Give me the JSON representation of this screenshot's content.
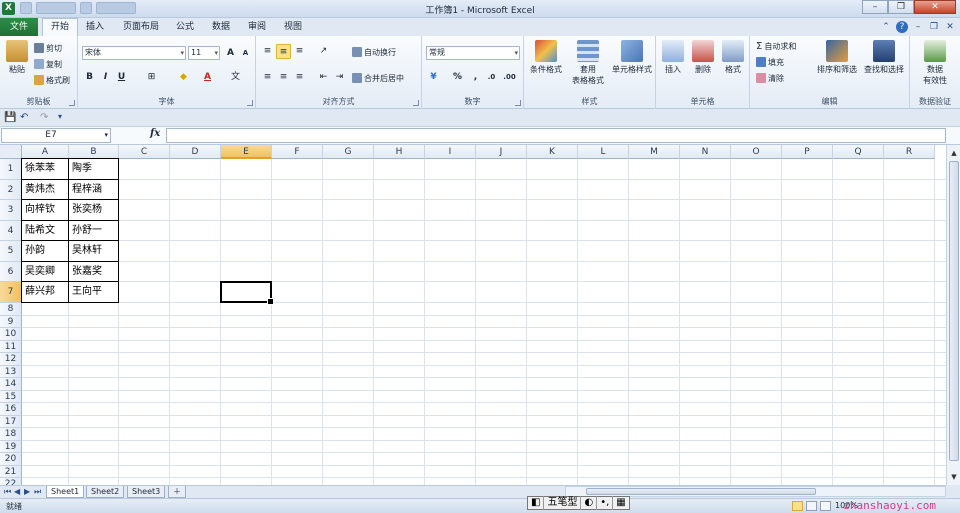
{
  "window": {
    "title": "工作簿1 - Microsoft Excel",
    "minimize": "–",
    "restore": "❐",
    "close": "✕"
  },
  "ribbon_tabs": [
    "文件",
    "开始",
    "插入",
    "页面布局",
    "公式",
    "数据",
    "审阅",
    "视图"
  ],
  "ribbon": {
    "clipboard": {
      "label": "剪贴板",
      "paste": "粘贴",
      "cut": "剪切",
      "copy": "复制",
      "format_painter": "格式刷"
    },
    "font": {
      "label": "字体",
      "font_name": "宋体",
      "font_size": "11",
      "bold": "B",
      "italic": "I",
      "underline": "U",
      "grow": "A",
      "shrink": "A"
    },
    "alignment": {
      "label": "对齐方式",
      "wrap": "自动换行",
      "merge": "合并后居中"
    },
    "number": {
      "label": "数字",
      "format": "常规",
      "percent": "%",
      "comma": ","
    },
    "styles": {
      "label": "样式",
      "conditional": "条件格式",
      "table_line1": "套用",
      "table_line2": "表格格式",
      "cell_styles": "单元格样式"
    },
    "cells": {
      "label": "单元格",
      "insert": "插入",
      "delete": "删除",
      "format": "格式"
    },
    "editing": {
      "label": "编辑",
      "autosum": "自动求和",
      "fill": "填充",
      "clear": "清除",
      "sort": "排序和筛选",
      "find": "查找和选择"
    },
    "validation": {
      "label": "数据验证",
      "name_line1": "数据",
      "name_line2": "有效性"
    }
  },
  "formula_bar": {
    "name_box": "E7",
    "fx": "fx",
    "content": ""
  },
  "columns": [
    "A",
    "B",
    "C",
    "D",
    "E",
    "F",
    "G",
    "H",
    "I",
    "J",
    "K",
    "L",
    "M",
    "N",
    "O",
    "P",
    "Q",
    "R"
  ],
  "rows": [
    "1",
    "2",
    "3",
    "4",
    "5",
    "6",
    "7",
    "8",
    "9",
    "10",
    "11",
    "12",
    "13",
    "14",
    "15",
    "16",
    "17",
    "18",
    "19",
    "20",
    "21",
    "22"
  ],
  "cells": [
    [
      "徐苯苯",
      "陶季"
    ],
    [
      "黄炜杰",
      "程梓涵"
    ],
    [
      "向梓钦",
      "张奕杨"
    ],
    [
      "陆希文",
      "孙舒一"
    ],
    [
      "孙韵",
      "吴林轩"
    ],
    [
      "吴奕卿",
      "张嘉奖"
    ],
    [
      "薛兴邦",
      "王向平"
    ]
  ],
  "selected_cell": {
    "column": "E",
    "row": "7"
  },
  "sheets": [
    "Sheet1",
    "Sheet2",
    "Sheet3"
  ],
  "active_sheet": "Sheet1",
  "status": {
    "ready": "就绪",
    "zoom": "100%",
    "ime": "五笔型"
  },
  "watermark": "zhanshaoyi.com"
}
